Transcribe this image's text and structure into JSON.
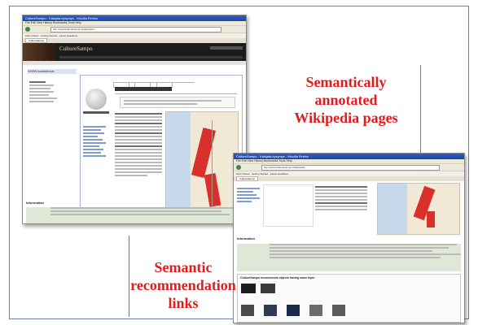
{
  "captions": {
    "annotated": [
      "Semantically",
      "annotated",
      "Wikipedia pages"
    ],
    "links": [
      "Semantic",
      "recommendation",
      "links"
    ]
  },
  "colors": {
    "caption": "#e01c1c",
    "frame": "#6b7fa8"
  },
  "shot1": {
    "window_title": "CultureSampo - Kaisjala-kysymys - Mozilla Firefox",
    "menu": "File  Edit  View  History  Bookmarks  Tools  Help",
    "url": "http://www.kulttuurisampo.fi/wikipedia/...",
    "site_logo": "CultureSampo",
    "header_search": "Search",
    "section_heading": "Information",
    "info_labels": [
      "Type",
      "Location",
      "Subject",
      "Media"
    ]
  },
  "shot2": {
    "window_title": "CultureSampo - Kaisjala-kysymys - Mozilla Firefox",
    "menu": "File  Edit  View  History  Bookmarks  Tools  Help",
    "url": "http://www.kulttuurisampo.fi/wikipedia/...",
    "section_heading": "Information",
    "recommend_heading": "CultureSampo recommends objects having same topic",
    "info_labels": [
      "Type",
      "Location",
      "Subject",
      "Media"
    ]
  }
}
